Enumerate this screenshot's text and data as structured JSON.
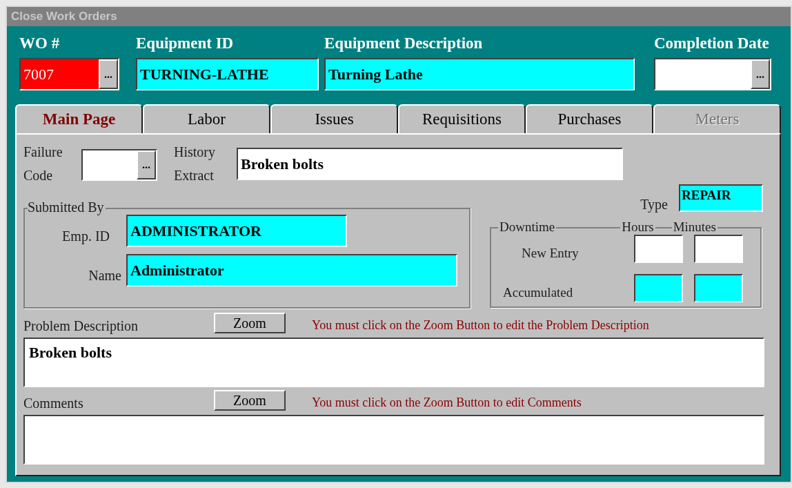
{
  "window": {
    "title": "Close Work Orders"
  },
  "header_fields": [
    {
      "label": "WO #",
      "value": "7007",
      "color": "#ff0000",
      "lookup": "..."
    },
    {
      "label": "Equipment ID",
      "value": "TURNING-LATHE",
      "color": "#00ffff"
    },
    {
      "label": "Equipment Description",
      "value": "Turning Lathe",
      "color": "#00ffff"
    },
    {
      "label": "Completion Date",
      "color": "#ffffff",
      "lookup": "..."
    }
  ],
  "tabs": [
    {
      "label": "Main Page",
      "selected": true,
      "disabled": false
    },
    {
      "label": "Labor",
      "selected": false,
      "disabled": false
    },
    {
      "label": "Issues",
      "selected": false,
      "disabled": false
    },
    {
      "label": "Requisitions",
      "selected": false,
      "disabled": false
    },
    {
      "label": "Purchases",
      "selected": false,
      "disabled": false
    },
    {
      "label": "Meters",
      "selected": false,
      "disabled": true
    }
  ],
  "failure_code": {
    "label": "Failure Code",
    "lookup": "..."
  },
  "history_extract": {
    "label": "History Extract",
    "value": "Broken bolts"
  },
  "submitted_by": {
    "title": "Submitted By",
    "emp_id": {
      "label": "Emp. ID",
      "value": "ADMINISTRATOR"
    },
    "name": {
      "label": "Name",
      "value": "Administrator"
    }
  },
  "type": {
    "label": "Type",
    "value": "REPAIR"
  },
  "downtime": {
    "title": "Downtime",
    "columns": [
      "Hours",
      "Minutes"
    ],
    "rows": [
      {
        "label": "New Entry",
        "color": "#ffffff"
      },
      {
        "label": "Accumulated",
        "color": "#00ffff"
      }
    ]
  },
  "memos": [
    {
      "label": "Problem Description",
      "button": "Zoom",
      "note": "You must click on the Zoom Button to edit the Problem Description",
      "value": "Broken bolts"
    },
    {
      "label": "Comments",
      "button": "Zoom",
      "note": "You must click on the Zoom Button to edit Comments"
    }
  ]
}
